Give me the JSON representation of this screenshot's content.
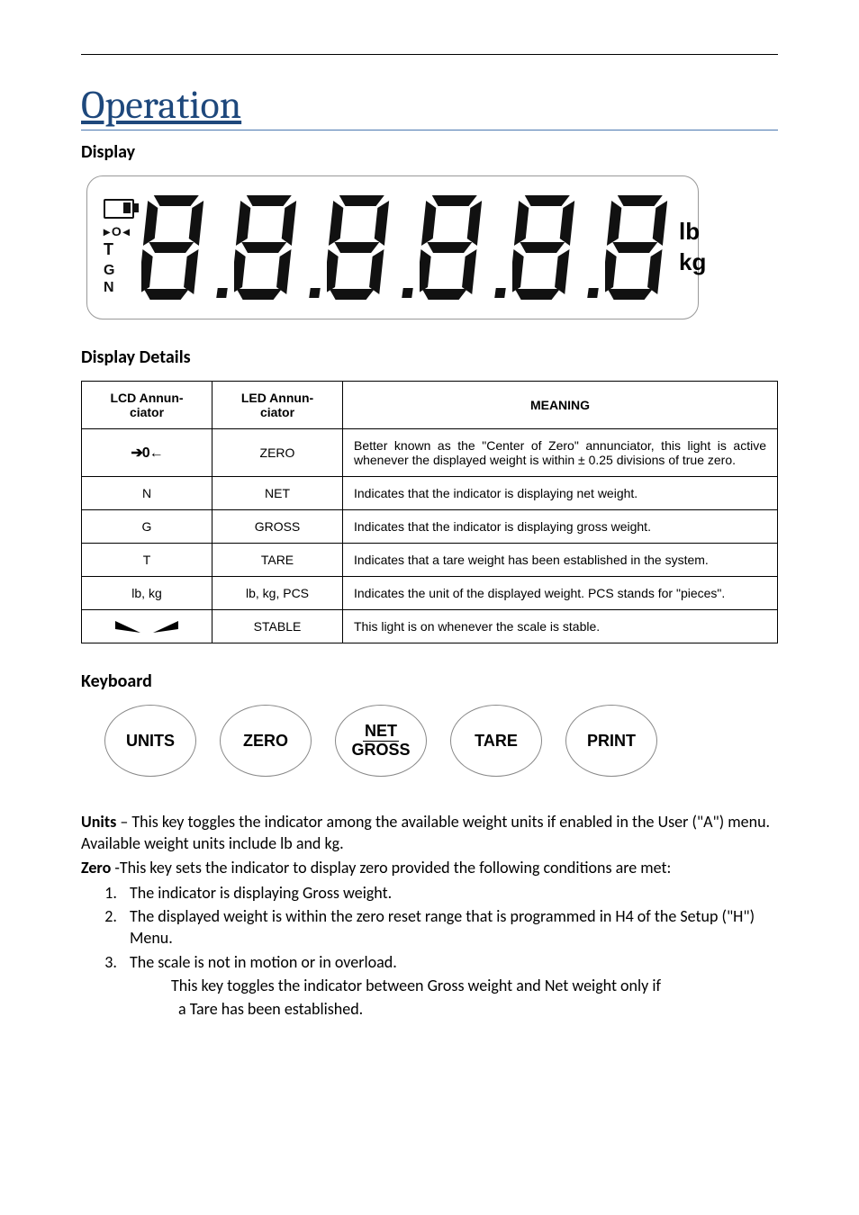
{
  "title": "Operation",
  "sections": {
    "display": "Display",
    "display_details": "Display Details",
    "keyboard": "Keyboard"
  },
  "lcd": {
    "annun": {
      "zero": "▸ O ◂",
      "t": "T",
      "gn": "G N"
    },
    "units": {
      "lb": "lb",
      "kg": "kg"
    }
  },
  "table": {
    "headers": {
      "lcd": "LCD Annun-\nciator",
      "led": "LED Annun-\nciator",
      "meaning": "MEANING"
    },
    "rows": [
      {
        "lcd_sym": "zero-arrows",
        "lcd": "➔0←",
        "led": "ZERO",
        "meaning": "Better known as the \"Center of Zero\" annunciator, this light is active whenever the displayed weight is within ± 0.25 divisions of true zero."
      },
      {
        "lcd": "N",
        "led": "NET",
        "meaning": "Indicates that the indicator is displaying net weight."
      },
      {
        "lcd": "G",
        "led": "GROSS",
        "meaning": "Indicates that the indicator is displaying gross weight."
      },
      {
        "lcd": "T",
        "led": "TARE",
        "meaning": "Indicates that a tare weight has been established in the system."
      },
      {
        "lcd": "lb, kg",
        "led": "lb, kg, PCS",
        "meaning": "Indicates the unit of the displayed weight. PCS stands for \"pieces\"."
      },
      {
        "lcd_sym": "stable",
        "lcd": "",
        "led": "STABLE",
        "meaning": "This light is on whenever the scale is stable."
      }
    ]
  },
  "keys": [
    {
      "id": "units",
      "line1": "UNITS"
    },
    {
      "id": "zero",
      "line1": "ZERO"
    },
    {
      "id": "netgross",
      "line1": "NET",
      "line2": "GROSS",
      "divider": true
    },
    {
      "id": "tare",
      "line1": "TARE"
    },
    {
      "id": "print",
      "line1": "PRINT"
    }
  ],
  "body": {
    "units_label": "Units",
    "units_text": " – This key toggles the indicator among the available weight units if enabled in the User (\"A\") menu. Available weight units include lb and kg.",
    "zero_label": "Zero",
    "zero_text": " -This key sets the indicator to display zero provided the following conditions are met:",
    "conditions": [
      "The indicator is displaying Gross weight.",
      "The displayed weight is within the zero reset range that is programmed in H4 of the Setup (\"H\") Menu.",
      "The scale is not in motion or in overload."
    ],
    "netgross_text1": "This key toggles the indicator between Gross weight and Net weight only if",
    "netgross_text2": "a Tare has been established."
  }
}
